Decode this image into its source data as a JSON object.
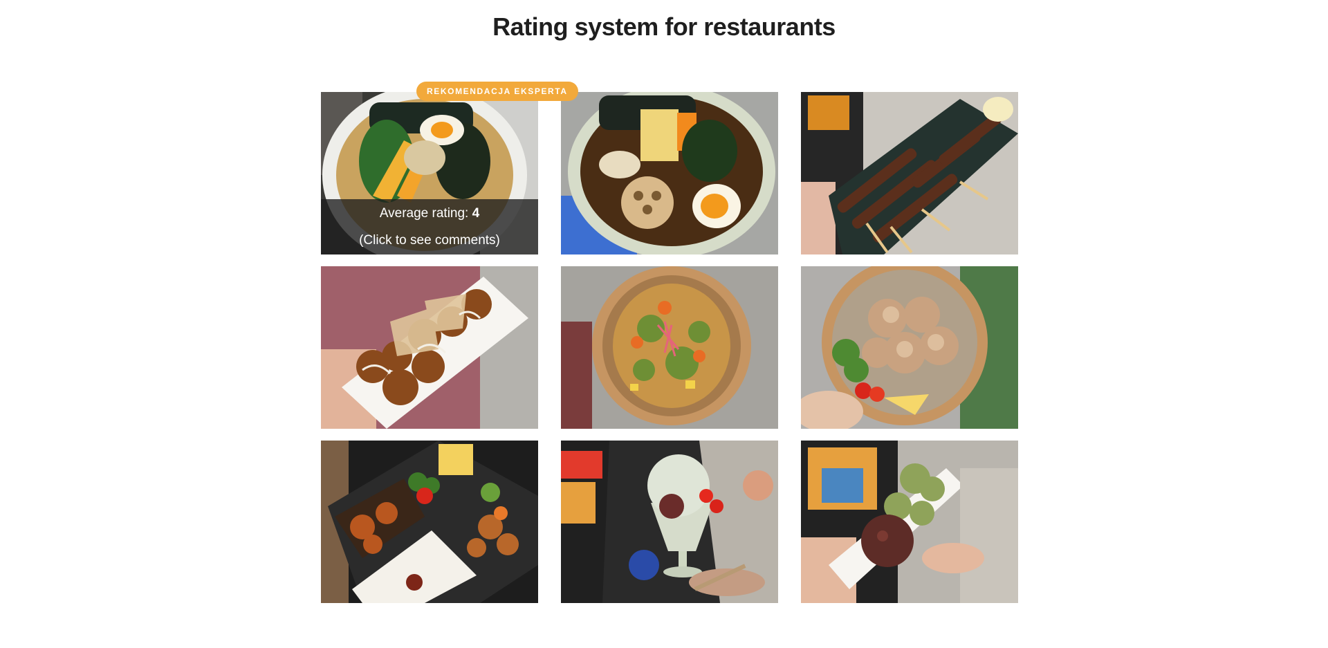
{
  "page": {
    "title": "Rating system for restaurants"
  },
  "badge": {
    "label": "REKOMENDACJA EKSPERTA",
    "color": "#f2a93b"
  },
  "overlay": {
    "rating_label": "Average rating:",
    "rating_value": "4",
    "comments_hint": "(Click to see comments)"
  },
  "tiles": [
    {
      "name": "ramen-bowl-photo"
    },
    {
      "name": "lotus-ramen-photo"
    },
    {
      "name": "yakitori-skewers-photo"
    },
    {
      "name": "takoyaki-plate-photo"
    },
    {
      "name": "okonomi-bowl-photo"
    },
    {
      "name": "karaage-bowl-photo"
    },
    {
      "name": "bento-box-photo"
    },
    {
      "name": "kakigori-dessert-photo"
    },
    {
      "name": "matcha-mochi-photo"
    }
  ]
}
